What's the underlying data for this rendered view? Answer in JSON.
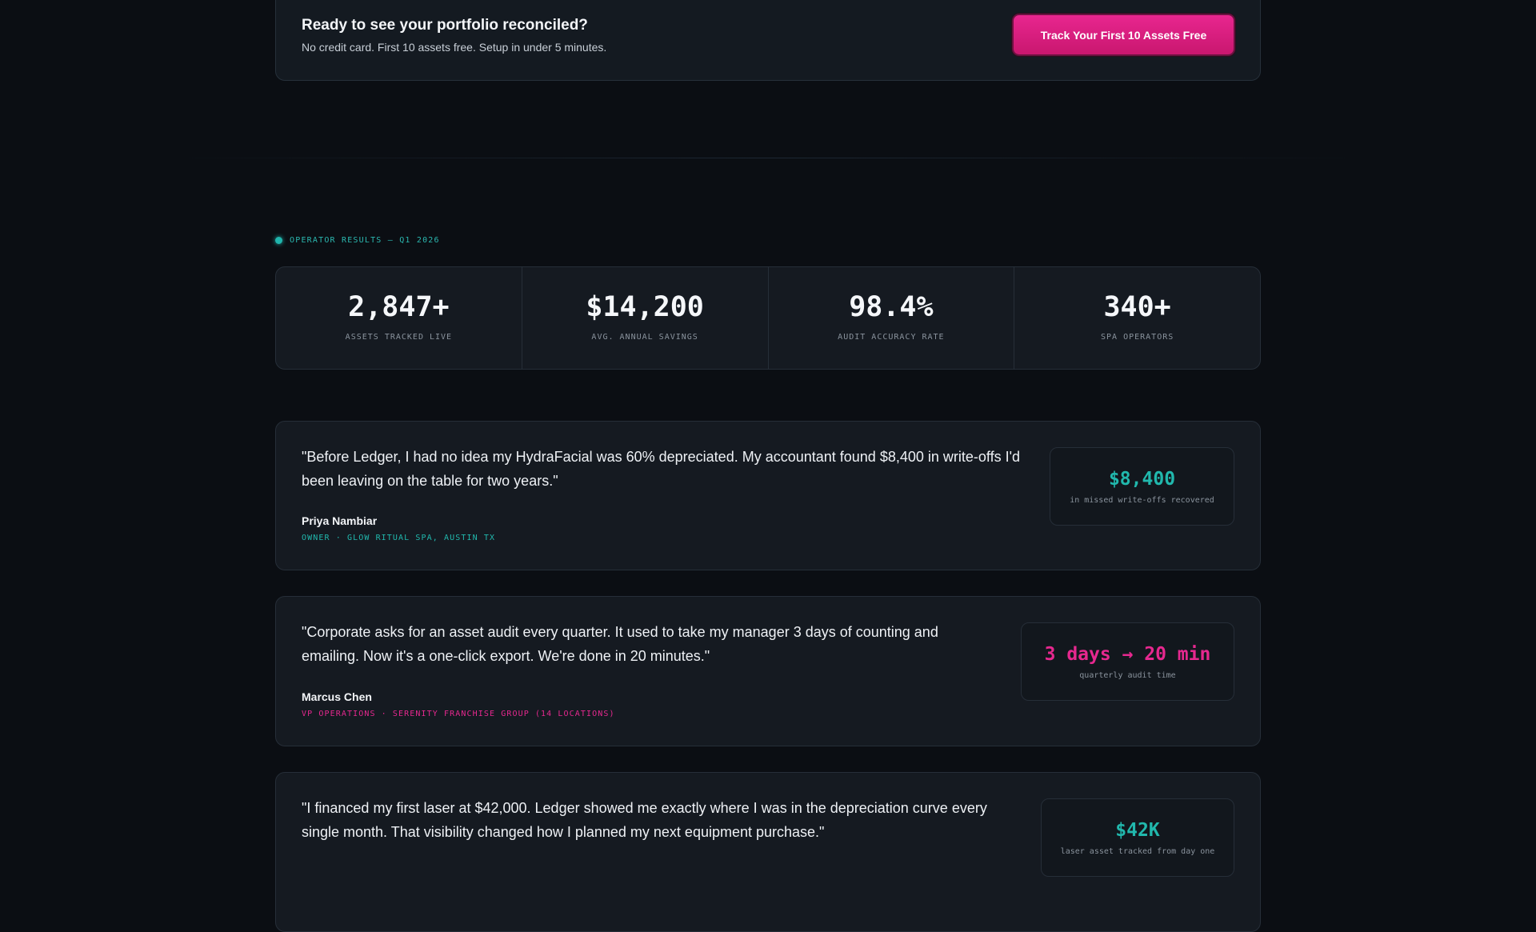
{
  "cta": {
    "title": "Ready to see your portfolio reconciled?",
    "subtitle": "No credit card. First 10 assets free. Setup in under 5 minutes.",
    "button_label": "Track Your First 10 Assets Free"
  },
  "section": {
    "label": "OPERATOR RESULTS — Q1 2026"
  },
  "stats": [
    {
      "value": "2,847+",
      "label": "ASSETS TRACKED LIVE"
    },
    {
      "value": "$14,200",
      "label": "AVG. ANNUAL SAVINGS"
    },
    {
      "value": "98.4%",
      "label": "AUDIT ACCURACY RATE"
    },
    {
      "value": "340+",
      "label": "SPA OPERATORS"
    }
  ],
  "testimonials": [
    {
      "quote": "\"Before Ledger, I had no idea my HydraFacial was 60% depreciated. My accountant found $8,400 in write-offs I'd been leaving on the table for two years.\"",
      "author": "Priya Nambiar",
      "role": "OWNER · GLOW RITUAL SPA, AUSTIN TX",
      "metric_value": "$8,400",
      "metric_label": "in missed write-offs recovered"
    },
    {
      "quote": "\"Corporate asks for an asset audit every quarter. It used to take my manager 3 days of counting and emailing. Now it's a one-click export. We're done in 20 minutes.\"",
      "author": "Marcus Chen",
      "role": "VP OPERATIONS · SERENITY FRANCHISE GROUP (14 LOCATIONS)",
      "metric_value": "3 days → 20 min",
      "metric_label": "quarterly audit time"
    },
    {
      "quote": "\"I financed my first laser at $42,000. Ledger showed me exactly where I was in the depreciation curve every single month. That visibility changed how I planned my next equipment purchase.\"",
      "author": "",
      "role": "",
      "metric_value": "$42K",
      "metric_label": "laser asset tracked from day one"
    }
  ],
  "colors": {
    "background": "#0b0e13",
    "card": "#151a21",
    "accent_teal": "#21b8ad",
    "accent_pink": "#e6288f"
  }
}
